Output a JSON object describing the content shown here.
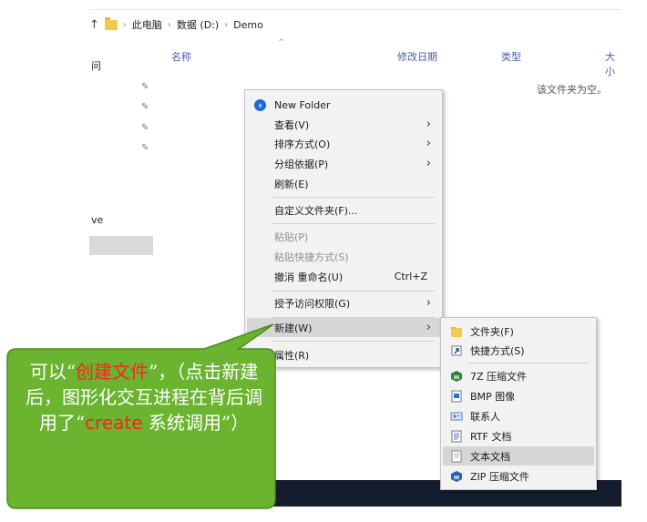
{
  "breadcrumb": {
    "this_pc": "此电脑",
    "drive": "数据 (D:)",
    "folder": "Demo",
    "sep": "›",
    "up": "↑"
  },
  "columns": {
    "name": "名称",
    "modified": "修改日期",
    "type": "类型",
    "size": "大小"
  },
  "empty_message": "该文件夹为空。",
  "nav_fragments": {
    "top": "问",
    "onedrive": "ve"
  },
  "context_menu": {
    "new_folder": "New Folder",
    "view": "查看(V)",
    "sort_by": "排序方式(O)",
    "group_by": "分组依据(P)",
    "refresh": "刷新(E)",
    "customize": "自定义文件夹(F)...",
    "paste": "粘贴(P)",
    "paste_shortcut": "粘贴快捷方式(S)",
    "undo_rename": "撤消 重命名(U)",
    "undo_shortcut": "Ctrl+Z",
    "grant_access": "授予访问权限(G)",
    "new": "新建(W)",
    "properties": "属性(R)"
  },
  "new_submenu": {
    "folder": "文件夹(F)",
    "shortcut": "快捷方式(S)",
    "sevenzip": "7Z 压缩文件",
    "bmp": "BMP 图像",
    "contact": "联系人",
    "rtf": "RTF 文档",
    "text": "文本文档",
    "zip": "ZIP 压缩文件"
  },
  "callout": {
    "part1": "可以“",
    "red1": "创建文件",
    "part2": "”，（点击新建后，图形化交互进程在背后调用了“",
    "red2": "create",
    "part3": " 系统调用”）"
  },
  "colors": {
    "callout_fill": "#6ab42f",
    "callout_border": "#4e8a22",
    "highlight_red": "#ff2020",
    "menu_bg": "#f2f2f2"
  }
}
